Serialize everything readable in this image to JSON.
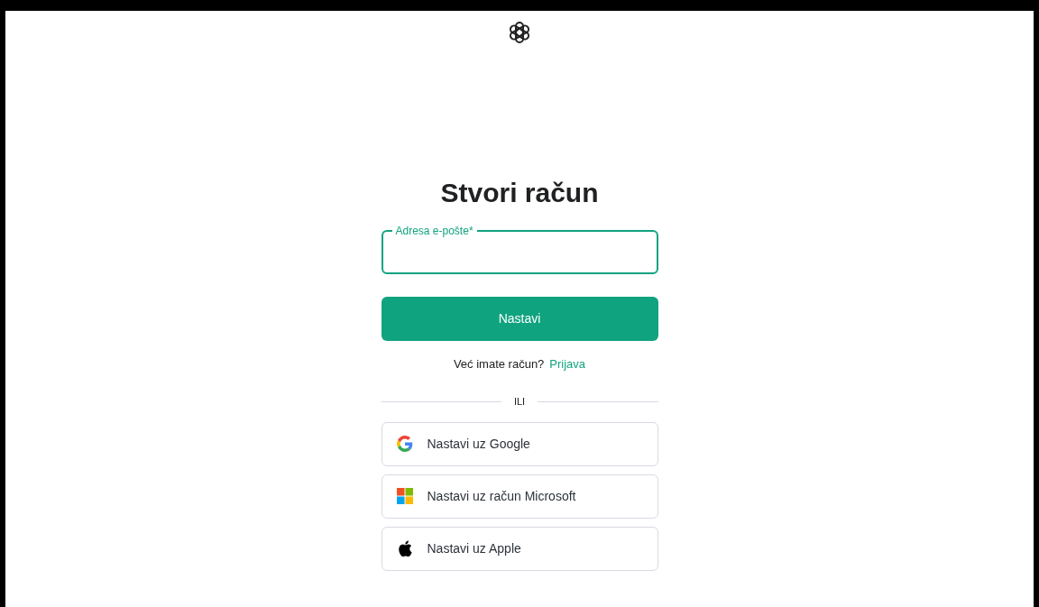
{
  "heading": "Stvori račun",
  "email_field": {
    "label": "Adresa e-pošte*"
  },
  "continue_button": "Nastavi",
  "signin_prompt": {
    "text": "Već imate račun?",
    "link": "Prijava"
  },
  "divider_text": "ILI",
  "social_buttons": [
    {
      "kind": "google",
      "label": "Nastavi uz Google"
    },
    {
      "kind": "microsoft",
      "label": "Nastavi uz račun Microsoft"
    },
    {
      "kind": "apple",
      "label": "Nastavi uz Apple"
    }
  ]
}
